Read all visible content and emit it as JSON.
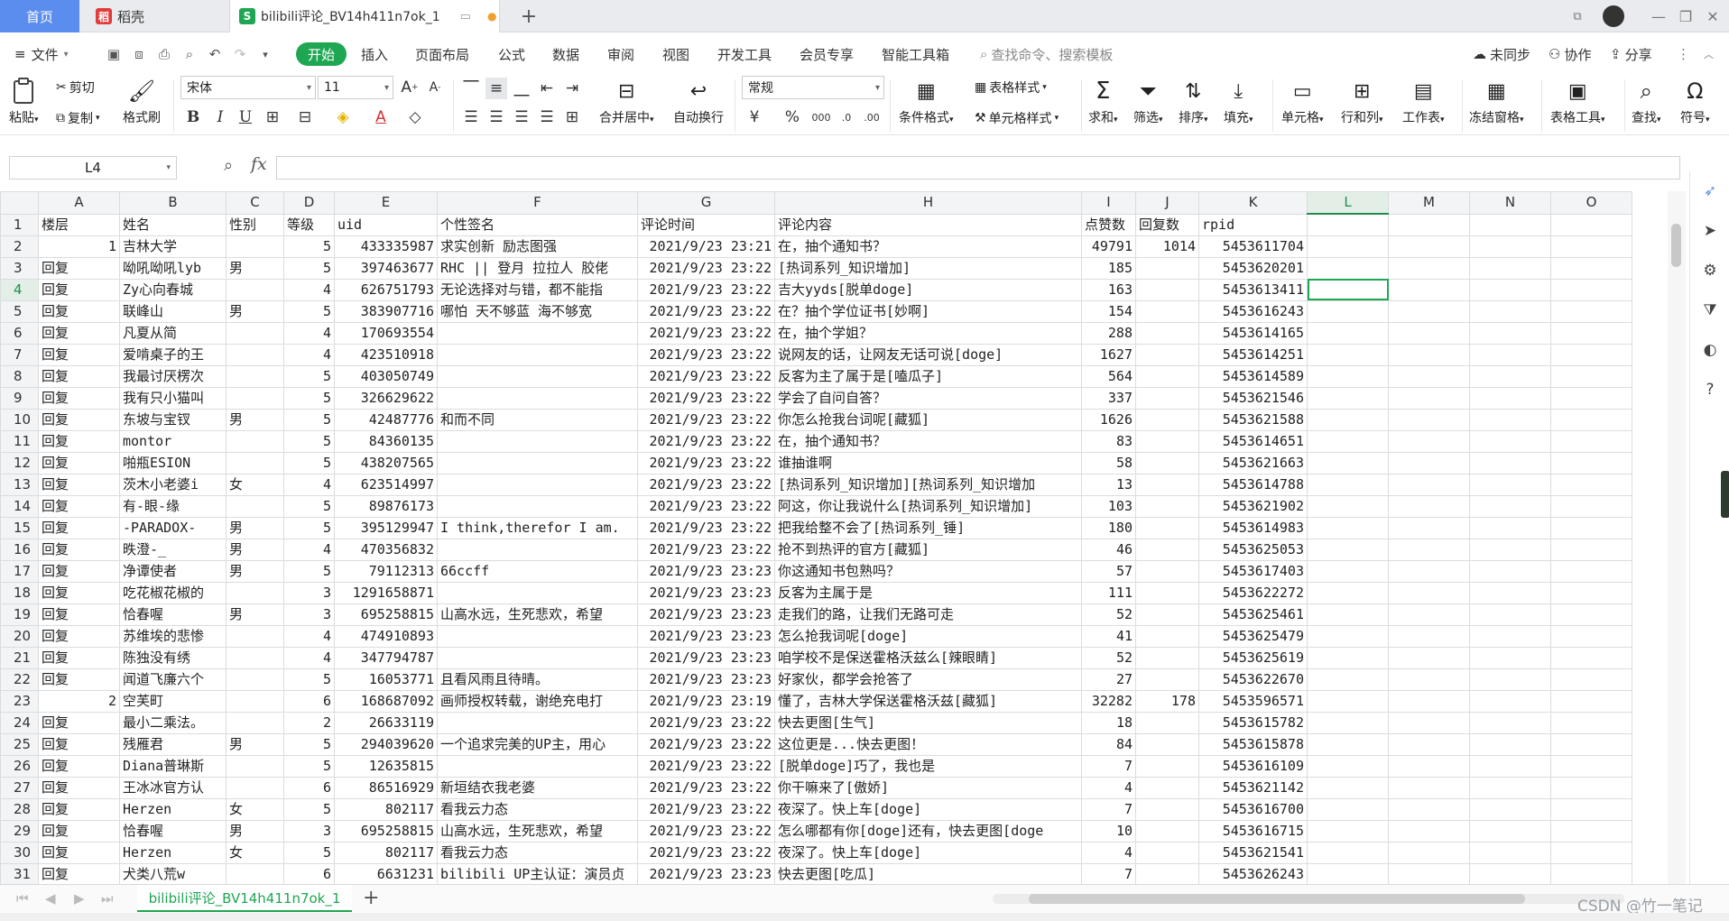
{
  "tabs": {
    "home": "首页",
    "wps": "稻壳",
    "doc": "bilibili评论_BV14h411n7ok_1"
  },
  "menu": {
    "file": "文件",
    "start": "开始",
    "insert": "插入",
    "layout": "页面布局",
    "formula": "公式",
    "data": "数据",
    "review": "审阅",
    "view": "视图",
    "devtools": "开发工具",
    "member": "会员专享",
    "smart": "智能工具箱",
    "search_placeholder": "查找命令、搜索模板",
    "unsynced": "未同步",
    "collab": "协作",
    "share": "分享"
  },
  "ribbon": {
    "paste": "粘贴",
    "cut": "剪切",
    "copy": "复制",
    "format_painter": "格式刷",
    "font_name": "宋体",
    "font_size": "11",
    "merge_center": "合并居中",
    "wrap": "自动换行",
    "number_format": "常规",
    "cond_format": "条件格式",
    "table_style": "表格样式",
    "cell_style": "单元格样式",
    "sum": "求和",
    "filter": "筛选",
    "sort": "排序",
    "fill": "填充",
    "cell": "单元格",
    "row_col": "行和列",
    "worksheet": "工作表",
    "freeze": "冻结窗格",
    "table_tools": "表格工具",
    "find": "查找",
    "symbol": "符号"
  },
  "formula_bar": {
    "name_box": "L4",
    "fx": "fx",
    "value": ""
  },
  "columns": [
    "A",
    "B",
    "C",
    "D",
    "E",
    "F",
    "G",
    "H",
    "I",
    "J",
    "K",
    "L",
    "M",
    "N",
    "O"
  ],
  "active_column": "L",
  "active_row": "4",
  "rows": [
    [
      "1",
      "楼层",
      "姓名",
      "性别",
      "等级",
      "uid",
      "个性签名",
      "评论时间",
      "评论内容",
      "点赞数",
      "回复数",
      "rpid",
      "",
      "",
      "",
      ""
    ],
    [
      "2",
      "1",
      "吉林大学",
      "",
      "5",
      "433335987",
      "求实创新 励志图强",
      "2021/9/23 23:21",
      "在，抽个通知书？",
      "49791",
      "1014",
      "5453611704",
      "",
      "",
      "",
      ""
    ],
    [
      "3",
      "回复",
      "呦吼呦吼lyb",
      "男",
      "5",
      "397463677",
      "RHC || 登月 拉拉人 胶佬",
      "2021/9/23 23:22",
      "[热词系列_知识增加]",
      "185",
      "",
      "5453620201",
      "",
      "",
      "",
      ""
    ],
    [
      "4",
      "回复",
      "Zy心向春城",
      "",
      "4",
      "626751793",
      "无论选择对与错，都不能指",
      "2021/9/23 23:22",
      "吉大yyds[脱单doge]",
      "163",
      "",
      "5453613411",
      "",
      "",
      "",
      ""
    ],
    [
      "5",
      "回复",
      "联峰山",
      "男",
      "5",
      "383907716",
      "哪怕 天不够蓝 海不够宽",
      "2021/9/23 23:22",
      "在？抽个学位证书[妙啊]",
      "154",
      "",
      "5453616243",
      "",
      "",
      "",
      ""
    ],
    [
      "6",
      "回复",
      "凡夏从简",
      "",
      "4",
      "170693554",
      "",
      "2021/9/23 23:22",
      "在，抽个学姐？",
      "288",
      "",
      "5453614165",
      "",
      "",
      "",
      ""
    ],
    [
      "7",
      "回复",
      "爱啃桌子的王",
      "",
      "4",
      "423510918",
      "",
      "2021/9/23 23:22",
      "说网友的话，让网友无话可说[doge]",
      "1627",
      "",
      "5453614251",
      "",
      "",
      "",
      ""
    ],
    [
      "8",
      "回复",
      "我最讨厌楞次",
      "",
      "5",
      "403050749",
      "",
      "2021/9/23 23:22",
      "反客为主了属于是[嗑瓜子]",
      "564",
      "",
      "5453614589",
      "",
      "",
      "",
      ""
    ],
    [
      "9",
      "回复",
      "我有只小猫叫",
      "",
      "5",
      "326629622",
      "",
      "2021/9/23 23:22",
      "学会了自问自答？",
      "337",
      "",
      "5453621546",
      "",
      "",
      "",
      ""
    ],
    [
      "10",
      "回复",
      "东坡与宝钗",
      "男",
      "5",
      "42487776",
      "和而不同",
      "2021/9/23 23:22",
      "你怎么抢我台词呢[藏狐]",
      "1626",
      "",
      "5453621588",
      "",
      "",
      "",
      ""
    ],
    [
      "11",
      "回复",
      "montor",
      "",
      "5",
      "84360135",
      "",
      "2021/9/23 23:22",
      "在，抽个通知书？",
      "83",
      "",
      "5453614651",
      "",
      "",
      "",
      ""
    ],
    [
      "12",
      "回复",
      "啪瓶ESION",
      "",
      "5",
      "438207565",
      "",
      "2021/9/23 23:22",
      "谁抽谁啊",
      "58",
      "",
      "5453621663",
      "",
      "",
      "",
      ""
    ],
    [
      "13",
      "回复",
      "茨木小老婆i",
      "女",
      "4",
      "623514997",
      "",
      "2021/9/23 23:22",
      "[热词系列_知识增加][热词系列_知识增加",
      "13",
      "",
      "5453614788",
      "",
      "",
      "",
      ""
    ],
    [
      "14",
      "回复",
      "有-眼-缘",
      "",
      "5",
      "89876173",
      "",
      "2021/9/23 23:22",
      "阿这，你让我说什么[热词系列_知识增加]",
      "103",
      "",
      "5453621902",
      "",
      "",
      "",
      ""
    ],
    [
      "15",
      "回复",
      "-PARADOX-",
      "男",
      "5",
      "395129947",
      "I think,therefor I am.",
      "2021/9/23 23:22",
      "把我给整不会了[热词系列_锤]",
      "180",
      "",
      "5453614983",
      "",
      "",
      "",
      ""
    ],
    [
      "16",
      "回复",
      "昳澄-_",
      "男",
      "4",
      "470356832",
      "",
      "2021/9/23 23:22",
      "抢不到热评的官方[藏狐]",
      "46",
      "",
      "5453625053",
      "",
      "",
      "",
      ""
    ],
    [
      "17",
      "回复",
      "净谭使者",
      "男",
      "5",
      "79112313",
      "66ccff",
      "2021/9/23 23:23",
      "你这通知书包熟吗？",
      "57",
      "",
      "5453617403",
      "",
      "",
      "",
      ""
    ],
    [
      "18",
      "回复",
      "吃花椒花椒的",
      "",
      "3",
      "1291658871",
      "",
      "2021/9/23 23:23",
      "反客为主属于是",
      "111",
      "",
      "5453622272",
      "",
      "",
      "",
      ""
    ],
    [
      "19",
      "回复",
      "恰春喔",
      "男",
      "3",
      "695258815",
      "山高水远，生死悲欢，希望",
      "2021/9/23 23:23",
      "走我们的路，让我们无路可走",
      "52",
      "",
      "5453625461",
      "",
      "",
      "",
      ""
    ],
    [
      "20",
      "回复",
      "苏维埃的悲惨",
      "",
      "4",
      "474910893",
      "",
      "2021/9/23 23:23",
      "怎么抢我词呢[doge]",
      "41",
      "",
      "5453625479",
      "",
      "",
      "",
      ""
    ],
    [
      "21",
      "回复",
      "陈独没有绣",
      "",
      "4",
      "347794787",
      "",
      "2021/9/23 23:23",
      "咱学校不是保送霍格沃兹么[辣眼睛]",
      "52",
      "",
      "5453625619",
      "",
      "",
      "",
      ""
    ],
    [
      "22",
      "回复",
      "闻道飞廉六个",
      "",
      "5",
      "16053771",
      "且看风雨且待晴。",
      "2021/9/23 23:23",
      "好家伙，都学会抢答了",
      "27",
      "",
      "5453622670",
      "",
      "",
      "",
      ""
    ],
    [
      "23",
      "2",
      "空芙町",
      "",
      "6",
      "168687092",
      "画师授权转载，谢绝充电打",
      "2021/9/23 23:19",
      "懂了，吉林大学保送霍格沃兹[藏狐]",
      "32282",
      "178",
      "5453596571",
      "",
      "",
      "",
      ""
    ],
    [
      "24",
      "回复",
      "最小二乘法。",
      "",
      "2",
      "26633119",
      "",
      "2021/9/23 23:22",
      "快去更图[生气]",
      "18",
      "",
      "5453615782",
      "",
      "",
      "",
      ""
    ],
    [
      "25",
      "回复",
      "残雁君",
      "男",
      "5",
      "294039620",
      "一个追求完美的UP主，用心",
      "2021/9/23 23:22",
      "这位更是...快去更图！",
      "84",
      "",
      "5453615878",
      "",
      "",
      "",
      ""
    ],
    [
      "26",
      "回复",
      "Diana普琳斯",
      "",
      "5",
      "12635815",
      "",
      "2021/9/23 23:22",
      "[脱单doge]巧了，我也是",
      "7",
      "",
      "5453616109",
      "",
      "",
      "",
      ""
    ],
    [
      "27",
      "回复",
      "王冰冰官方认",
      "",
      "6",
      "86516929",
      "新垣结衣我老婆",
      "2021/9/23 23:22",
      "你干嘛来了[傲娇]",
      "4",
      "",
      "5453621142",
      "",
      "",
      "",
      ""
    ],
    [
      "28",
      "回复",
      "Herzen",
      "女",
      "5",
      "802117",
      "看我云力态",
      "2021/9/23 23:22",
      "夜深了。快上车[doge]",
      "7",
      "",
      "5453616700",
      "",
      "",
      "",
      ""
    ],
    [
      "29",
      "回复",
      "恰春喔",
      "男",
      "3",
      "695258815",
      "山高水远，生死悲欢，希望",
      "2021/9/23 23:22",
      "怎么哪都有你[doge]还有，快去更图[doge",
      "10",
      "",
      "5453616715",
      "",
      "",
      "",
      ""
    ],
    [
      "30",
      "回复",
      "Herzen",
      "女",
      "5",
      "802117",
      "看我云力态",
      "2021/9/23 23:22",
      "夜深了。快上车[doge]",
      "4",
      "",
      "5453621541",
      "",
      "",
      "",
      ""
    ],
    [
      "31",
      "回复",
      "犬类八荒w",
      "",
      "6",
      "6631231",
      "bilibili UP主认证：演员贞",
      "2021/9/23 23:23",
      "快去更图[吃瓜]",
      "7",
      "",
      "5453626243",
      "",
      "",
      "",
      ""
    ]
  ],
  "sheet": {
    "name": "bilibili评论_BV14h411n7ok_1"
  },
  "watermark": "CSDN @竹一笔记",
  "colors": {
    "accent": "#1fa653",
    "home_tab": "#5b8def"
  }
}
